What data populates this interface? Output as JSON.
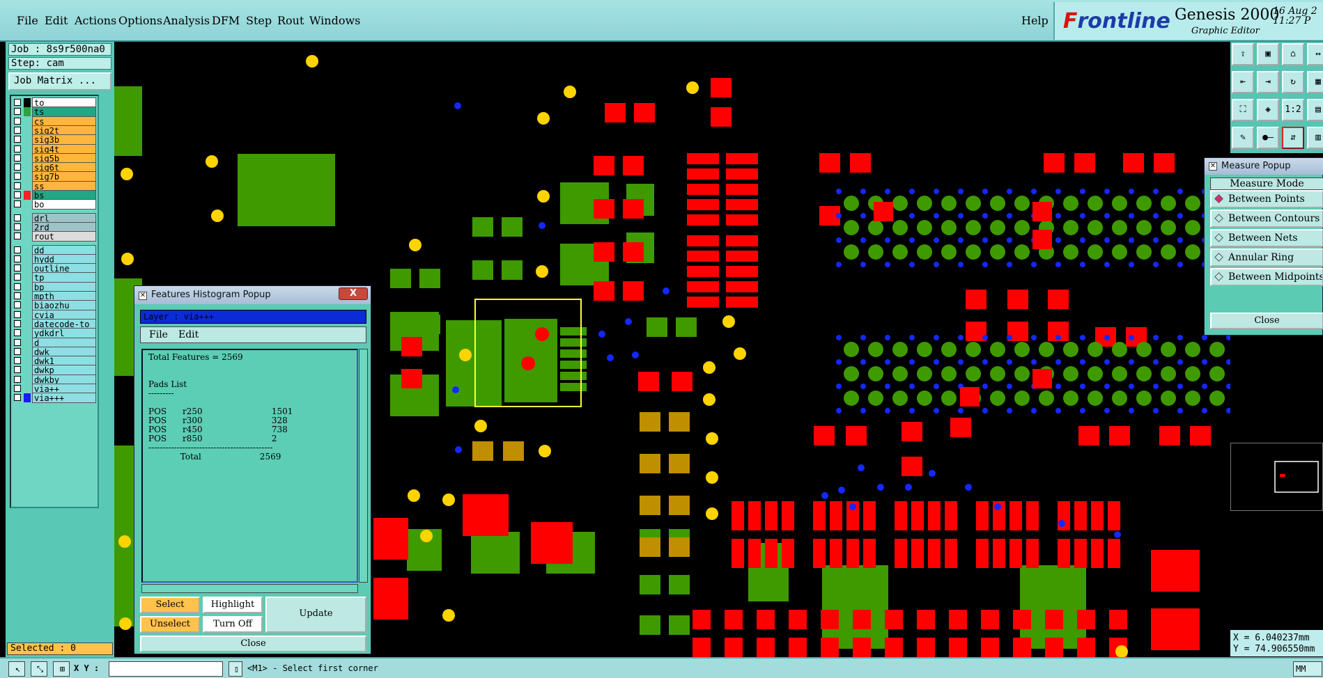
{
  "menubar": {
    "items": [
      "File",
      "Edit",
      "Actions",
      "Options",
      "Analysis",
      "DFM",
      "Step",
      "Rout",
      "Windows"
    ],
    "help": "Help"
  },
  "brand": {
    "logo_prefix": "F",
    "logo_rest": "rontline",
    "product": "Genesis 2000",
    "subtitle": "Graphic Editor",
    "date": "16 Aug 2",
    "time": "11:27 P"
  },
  "left_panel": {
    "job": "Job : 8s9r500na0",
    "step": "Step: cam",
    "job_matrix": "Job Matrix ...",
    "selected": "Selected : 0",
    "layers": [
      {
        "name": "to",
        "color": "#ffffff",
        "indicator": "#000000"
      },
      {
        "name": "ts",
        "color": "#1ea884",
        "indicator": "#2da340"
      },
      {
        "name": "cs",
        "color": "#ffb63c",
        "indicator": ""
      },
      {
        "name": "sig2t",
        "color": "#ffb63c",
        "indicator": ""
      },
      {
        "name": "sig3b",
        "color": "#ffb63c",
        "indicator": ""
      },
      {
        "name": "sig4t",
        "color": "#ffb63c",
        "indicator": ""
      },
      {
        "name": "sig5b",
        "color": "#ffb63c",
        "indicator": ""
      },
      {
        "name": "sig6t",
        "color": "#ffb63c",
        "indicator": ""
      },
      {
        "name": "sig7b",
        "color": "#ffb63c",
        "indicator": ""
      },
      {
        "name": "ss",
        "color": "#ffb63c",
        "indicator": ""
      },
      {
        "name": "bs",
        "color": "#1ea884",
        "indicator": "#ff2020"
      },
      {
        "name": "bo",
        "color": "#ffffff",
        "indicator": ""
      },
      {
        "name": "drl",
        "color": "#9ec4c8",
        "indicator": ""
      },
      {
        "name": "2rd",
        "color": "#9ec4c8",
        "indicator": ""
      },
      {
        "name": "rout",
        "color": "#dcdcdc",
        "indicator": ""
      },
      {
        "name": "dd",
        "color": "#8ddfe3",
        "indicator": ""
      },
      {
        "name": "hydd",
        "color": "#8ddfe3",
        "indicator": ""
      },
      {
        "name": "outline",
        "color": "#8ddfe3",
        "indicator": ""
      },
      {
        "name": "tp",
        "color": "#8ddfe3",
        "indicator": ""
      },
      {
        "name": "bp",
        "color": "#8ddfe3",
        "indicator": ""
      },
      {
        "name": "mpth",
        "color": "#8ddfe3",
        "indicator": ""
      },
      {
        "name": "biaozhu",
        "color": "#8ddfe3",
        "indicator": ""
      },
      {
        "name": "cvia",
        "color": "#8ddfe3",
        "indicator": ""
      },
      {
        "name": "datecode-to",
        "color": "#8ddfe3",
        "indicator": ""
      },
      {
        "name": "ydkdrl",
        "color": "#8ddfe3",
        "indicator": ""
      },
      {
        "name": "d",
        "color": "#8ddfe3",
        "indicator": ""
      },
      {
        "name": "dwk",
        "color": "#8ddfe3",
        "indicator": ""
      },
      {
        "name": "dwk1",
        "color": "#8ddfe3",
        "indicator": ""
      },
      {
        "name": "dwkp",
        "color": "#8ddfe3",
        "indicator": ""
      },
      {
        "name": "dwkby",
        "color": "#8ddfe3",
        "indicator": ""
      },
      {
        "name": "via++",
        "color": "#8ddfe3",
        "indicator": ""
      },
      {
        "name": "via+++",
        "color": "#8ddfe3",
        "indicator": "#1a1aff"
      }
    ]
  },
  "histogram_popup": {
    "title": "Features Histogram Popup",
    "close_x": "X",
    "layer": "Layer :  via+++",
    "menu_file": "File",
    "menu_edit": "Edit",
    "report": "Total Features = 2569\n\n\nPads List\n---------\n\nPOS      r250                          1501\nPOS      r300                          328\nPOS      r450                          738\nPOS      r850                          2\n--------------------------------------------\n            Total                      2569",
    "select": "Select",
    "unselect": "Unselect",
    "highlight": "Highlight",
    "turn_off": "Turn Off",
    "update": "Update",
    "close": "Close"
  },
  "measure_popup": {
    "title": "Measure Popup",
    "header": "Measure Mode",
    "options": [
      {
        "label": "Between Points",
        "selected": true
      },
      {
        "label": "Between Contours",
        "selected": false
      },
      {
        "label": "Between Nets",
        "selected": false
      },
      {
        "label": "Annular Ring",
        "selected": false
      },
      {
        "label": "Between Midpoints",
        "selected": false
      }
    ],
    "close": "Close"
  },
  "coords": {
    "x": "X = 6.040237mm",
    "y": "Y = 74.906550mm"
  },
  "statusbar": {
    "xy_label": "X Y :",
    "xy_value": "",
    "message": "<M1> - Select first corner",
    "units": "MM"
  },
  "colors": {
    "pad_red": "#ff0000",
    "pad_green": "#3f9a00",
    "pad_yellow": "#ffd400",
    "via_blue": "#1428ff",
    "overlap": "#bf8f00",
    "selection_box": "#ffff33"
  }
}
